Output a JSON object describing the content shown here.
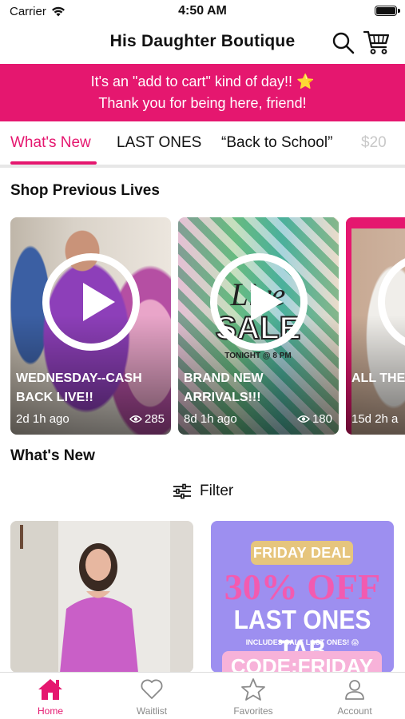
{
  "status_bar": {
    "carrier": "Carrier",
    "time": "4:50 AM"
  },
  "header": {
    "title": "His Daughter Boutique",
    "search_icon": "search-icon",
    "cart_icon": "cart-icon"
  },
  "banner": {
    "line1": "It's an \"add to cart\" kind of day!!",
    "star": "⭐",
    "line2": "Thank you for being here, friend!"
  },
  "tabs": [
    {
      "label": "What's New",
      "active": true
    },
    {
      "label": "LAST ONES"
    },
    {
      "label": "“Back to School”"
    },
    {
      "label": "$20"
    }
  ],
  "lives_section": {
    "title": "Shop Previous Lives"
  },
  "lives": [
    {
      "title": "WEDNESDAY--CASH BACK LIVE!!",
      "age": "2d 1h ago",
      "views": "285"
    },
    {
      "title": "BRAND NEW ARRIVALS!!!",
      "age": "8d 1h ago",
      "views": "180",
      "overlay": {
        "script": "Live",
        "sale": "SALE",
        "time": "TONIGHT @ 8 PM"
      }
    },
    {
      "title": "ALL THE",
      "age": "15d 2h a"
    }
  ],
  "whats_new": {
    "title": "What's New",
    "filter_label": "Filter"
  },
  "deal_card": {
    "pill": "FRIDAY DEAL",
    "big": "30% OFF",
    "tab": "LAST ONES TAB",
    "small": "INCLUDES SALE LAST ONES! 😱",
    "code": "CODE:FRIDAY"
  },
  "bottom_nav": [
    {
      "label": "Home",
      "icon": "home-icon",
      "active": true
    },
    {
      "label": "Waitlist",
      "icon": "heart-icon"
    },
    {
      "label": "Favorites",
      "icon": "star-icon"
    },
    {
      "label": "Account",
      "icon": "person-icon"
    }
  ],
  "colors": {
    "accent": "#e5176f",
    "deal_bg": "#9d8ff0",
    "deal_pink": "#f25bb0",
    "deal_gold": "#e6c57d"
  }
}
